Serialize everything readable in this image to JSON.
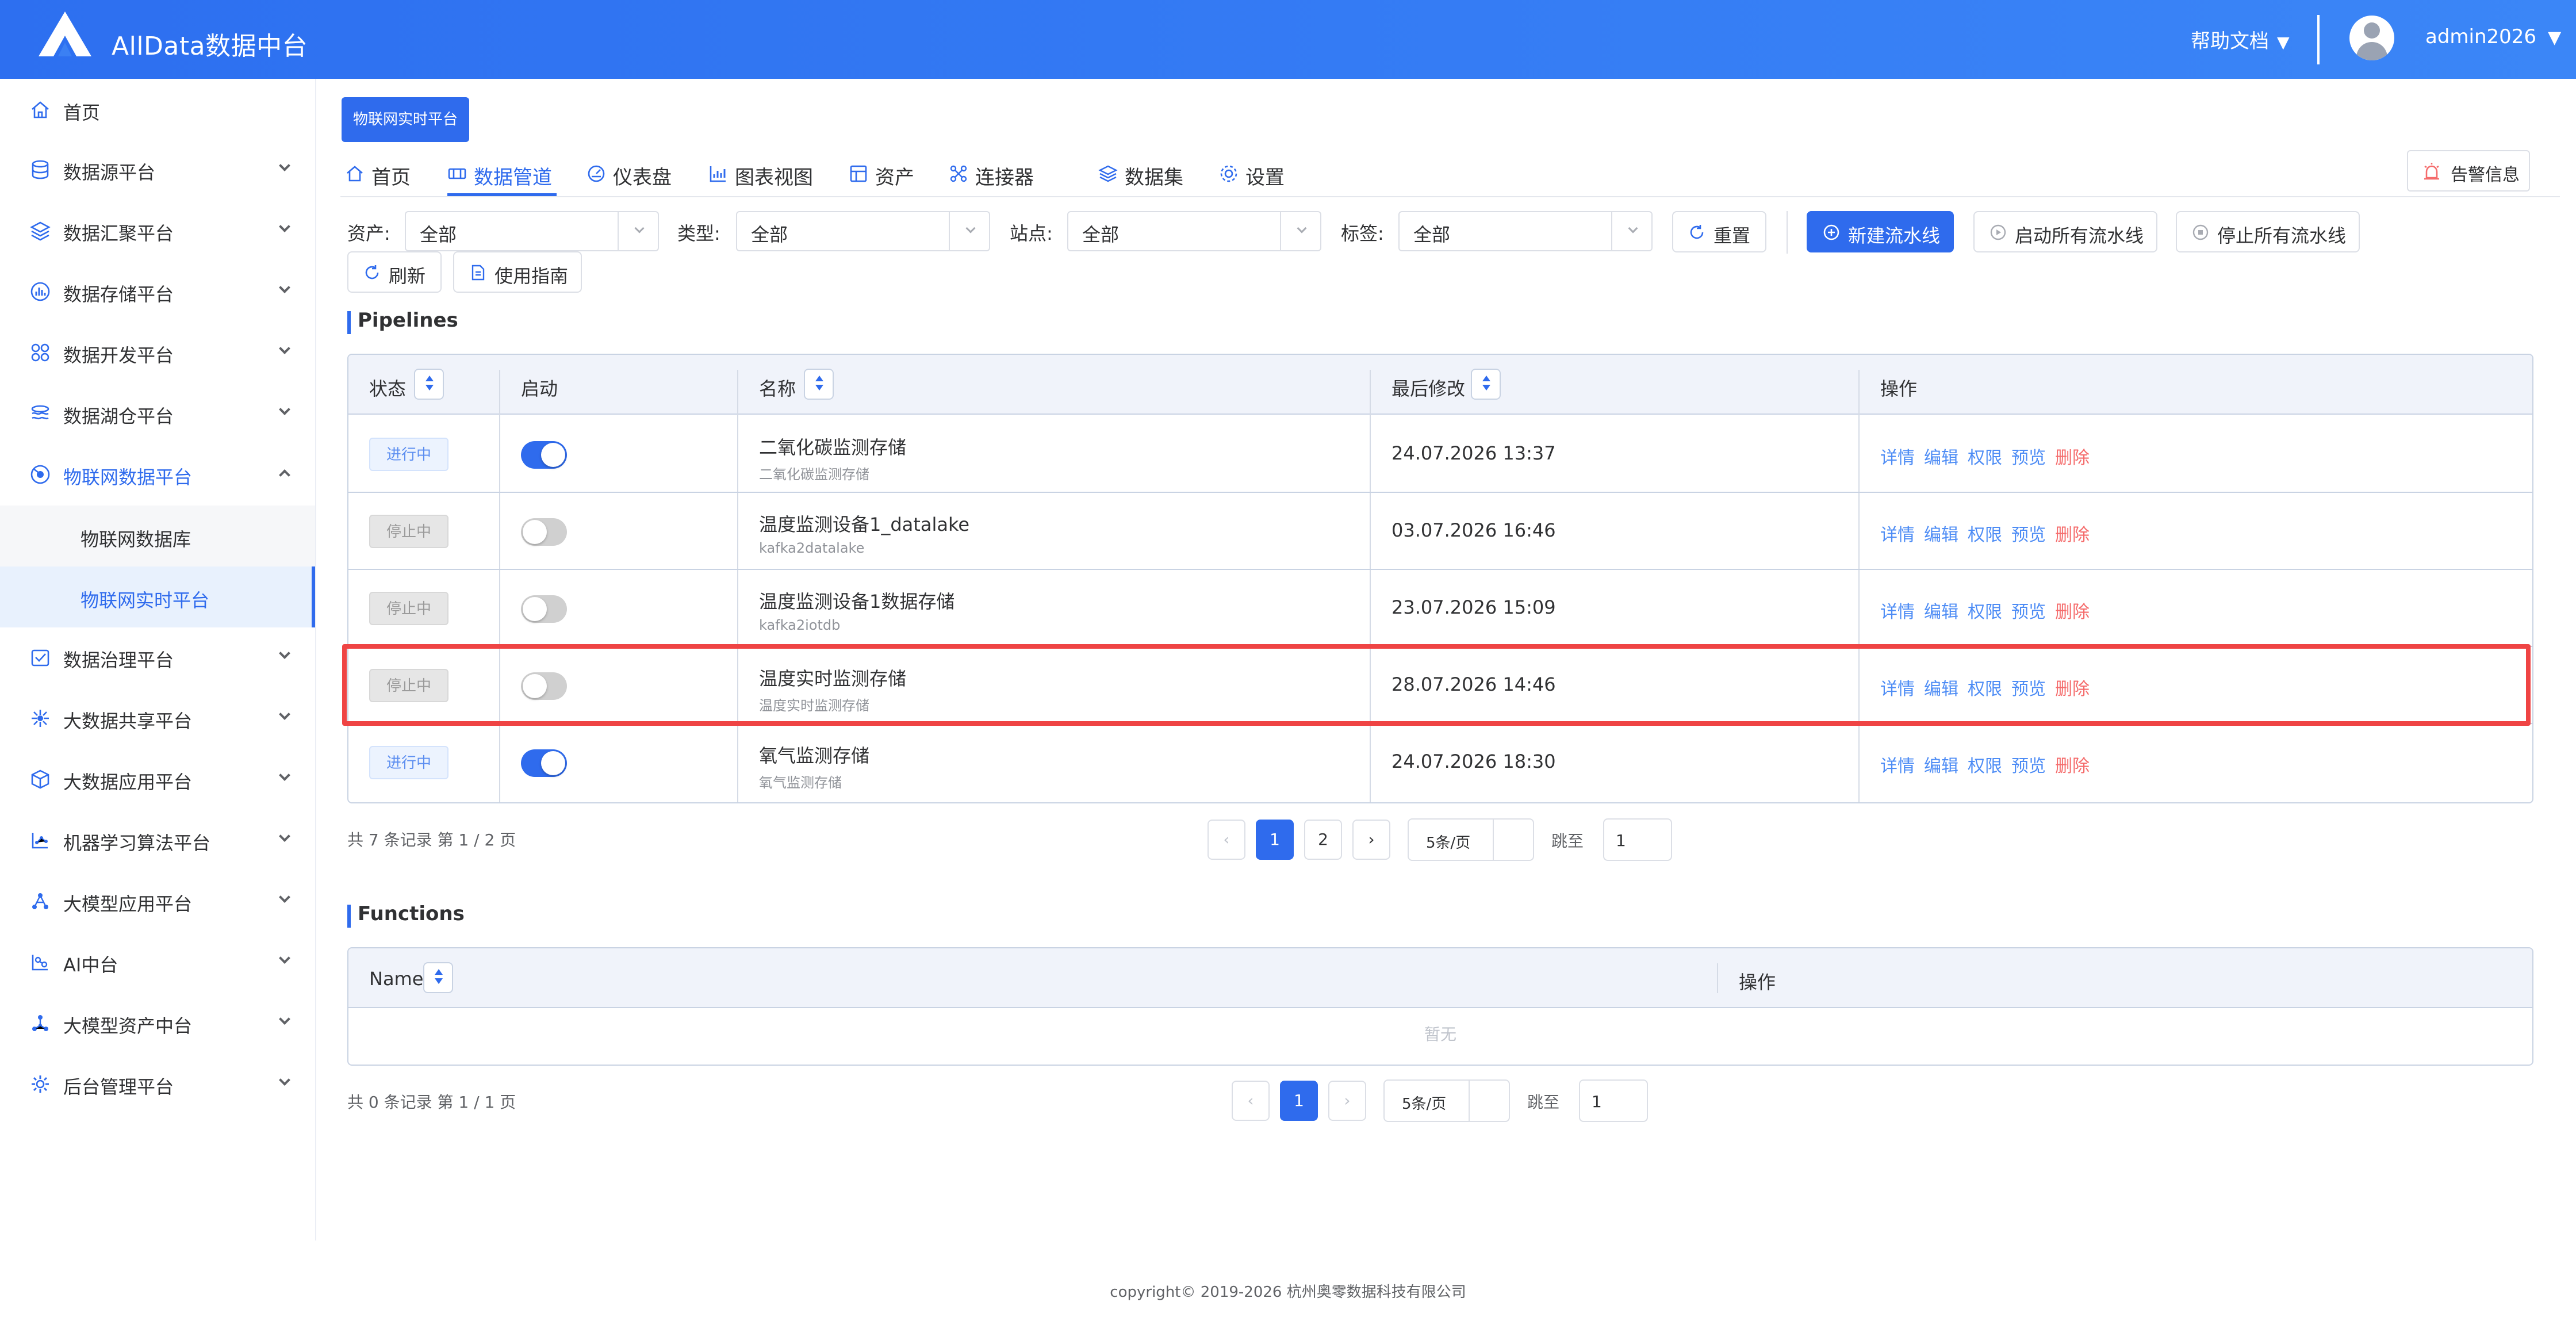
{
  "header": {
    "app_title": "AllData数据中台",
    "help_label": "帮助文档",
    "help_caret": "▼",
    "user_name": "admin2026",
    "user_caret": "▼"
  },
  "sidebar": {
    "items": [
      {
        "label": "首页",
        "icon": "home-icon"
      },
      {
        "label": "数据源平台",
        "icon": "database-icon"
      },
      {
        "label": "数据汇聚平台",
        "icon": "layers-icon"
      },
      {
        "label": "数据存储平台",
        "icon": "storage-chart-icon"
      },
      {
        "label": "数据开发平台",
        "icon": "grid-icon"
      },
      {
        "label": "数据湖仓平台",
        "icon": "lake-icon"
      },
      {
        "label": "物联网数据平台",
        "icon": "iot-icon"
      },
      {
        "label": "数据治理平台",
        "icon": "checklist-icon"
      },
      {
        "label": "大数据共享平台",
        "icon": "share-icon"
      },
      {
        "label": "大数据应用平台",
        "icon": "cube-icon"
      },
      {
        "label": "机器学习算法平台",
        "icon": "ml-icon"
      },
      {
        "label": "大模型应用平台",
        "icon": "model-app-icon"
      },
      {
        "label": "AI中台",
        "icon": "ai-icon"
      },
      {
        "label": "大模型资产中台",
        "icon": "asset-network-icon"
      },
      {
        "label": "后台管理平台",
        "icon": "admin-gear-icon"
      }
    ],
    "sub_items": [
      {
        "label": "物联网数据库"
      },
      {
        "label": "物联网实时平台"
      }
    ]
  },
  "page_tag": "物联网实时平台",
  "tabs": [
    {
      "label": "首页",
      "icon": "home-icon"
    },
    {
      "label": "数据管道",
      "icon": "pipeline-icon"
    },
    {
      "label": "仪表盘",
      "icon": "dashboard-icon"
    },
    {
      "label": "图表视图",
      "icon": "chart-icon"
    },
    {
      "label": "资产",
      "icon": "asset-icon"
    },
    {
      "label": "连接器",
      "icon": "connector-icon"
    },
    {
      "label": "数据集",
      "icon": "dataset-icon"
    },
    {
      "label": "设置",
      "icon": "settings-icon"
    }
  ],
  "alarm_label": "告警信息",
  "filters": {
    "asset_label": "资产:",
    "asset_value": "全部",
    "type_label": "类型:",
    "type_value": "全部",
    "site_label": "站点:",
    "site_value": "全部",
    "tag_label": "标签:",
    "tag_value": "全部"
  },
  "actions": {
    "reset": "重置",
    "new_pipeline": "新建流水线",
    "start_all": "启动所有流水线",
    "stop_all": "停止所有流水线",
    "refresh": "刷新",
    "guide": "使用指南"
  },
  "pipelines": {
    "title": "Pipelines",
    "columns": {
      "status": "状态",
      "enabled": "启动",
      "name": "名称",
      "modified": "最后修改",
      "ops": "操作"
    },
    "ops_labels": {
      "detail": "详情",
      "edit": "编辑",
      "permission": "权限",
      "preview": "预览",
      "delete": "删除"
    },
    "rows": [
      {
        "status": "进行中",
        "running": true,
        "name": "二氧化碳监测存储",
        "sub": "二氧化碳监测存储",
        "modified": "24.07.2026 13:37"
      },
      {
        "status": "停止中",
        "running": false,
        "name": "温度监测设备1_datalake",
        "sub": "kafka2datalake",
        "modified": "03.07.2026 16:46"
      },
      {
        "status": "停止中",
        "running": false,
        "name": "温度监测设备1数据存储",
        "sub": "kafka2iotdb",
        "modified": "23.07.2026 15:09"
      },
      {
        "status": "停止中",
        "running": false,
        "name": "温度实时监测存储",
        "sub": "温度实时监测存储",
        "modified": "28.07.2026 14:46"
      },
      {
        "status": "进行中",
        "running": true,
        "name": "氧气监测存储",
        "sub": "氧气监测存储",
        "modified": "24.07.2026 18:30"
      }
    ],
    "pager": {
      "total_text": "共 7 条记录 第 1 / 2 页",
      "prev": "‹",
      "next": "›",
      "pages": [
        "1",
        "2"
      ],
      "current": "1",
      "page_size": "5条/页",
      "jump_label": "跳至",
      "jump_value": "1"
    }
  },
  "functions": {
    "title": "Functions",
    "columns": {
      "name": "Name",
      "ops": "操作"
    },
    "empty_text": "暂无",
    "pager": {
      "total_text": "共 0 条记录 第 1 / 1 页",
      "prev": "‹",
      "next": "›",
      "current": "1",
      "page_size": "5条/页",
      "jump_label": "跳至",
      "jump_value": "1"
    }
  },
  "footer": "copyright© 2019-2026 杭州奥零数据科技有限公司",
  "colors": {
    "primary": "#2f6bed",
    "danger": "#f56c6c",
    "highlight": "#ef4444",
    "link": "#4d8cf5"
  }
}
